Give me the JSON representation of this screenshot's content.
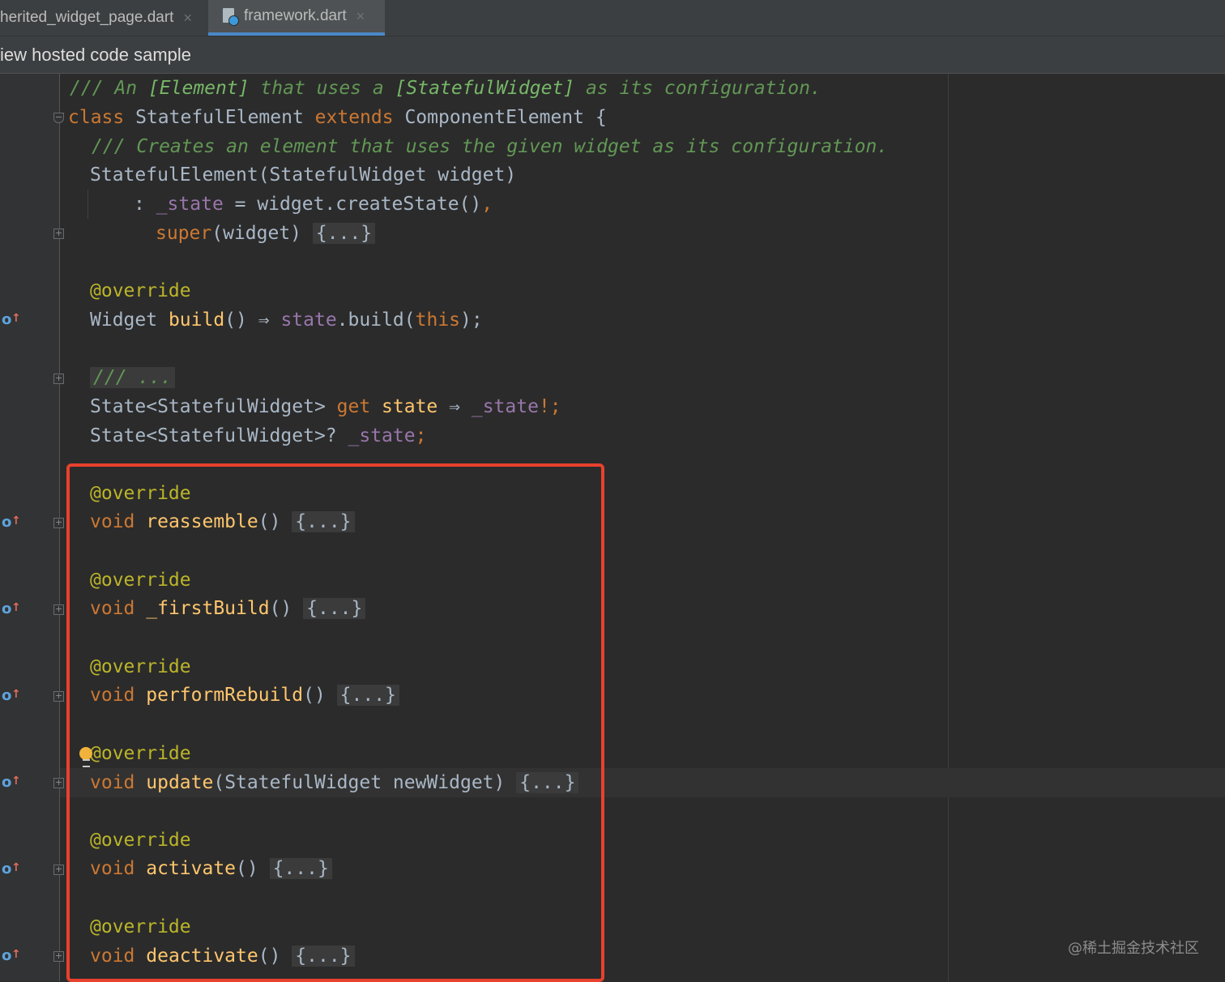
{
  "tabs": [
    {
      "label": "herited_widget_page.dart",
      "close": "×",
      "active": false
    },
    {
      "label": "framework.dart",
      "close": "×",
      "active": true
    }
  ],
  "hosted_banner": "iew hosted code sample",
  "code": {
    "l1": {
      "p1": "/// An ",
      "p2": "[Element]",
      "p3": " that uses a ",
      "p4": "[StatefulWidget]",
      "p5": " as its configuration."
    },
    "l2": {
      "kw1": "class",
      "p1": " StatefulElement ",
      "kw2": "extends",
      "p2": " ComponentElement {"
    },
    "l3": "/// Creates an element that uses the given widget as its configuration.",
    "l4": "StatefulElement(StatefulWidget widget)",
    "l5": {
      "p1": ": ",
      "fld": "_state",
      "p2": " = widget.createState()",
      "p3": ","
    },
    "l6": {
      "kw": "super",
      "p1": "(widget) ",
      "fold": "{...}"
    },
    "l7": "@override",
    "l8": {
      "p1": "Widget ",
      "fn": "build",
      "p2": "() ⇒ ",
      "fld": "state",
      "p3": ".build(",
      "kw": "this",
      "p4": ");"
    },
    "l9": "/// ...",
    "l10": {
      "p1": "State<StatefulWidget> ",
      "kw": "get",
      "p2": " ",
      "fn": "state",
      "p3": " ⇒ ",
      "fld": "_state",
      "p4": "!;"
    },
    "l11": {
      "p1": "State<StatefulWidget>? ",
      "fld": "_state",
      "p2": ";"
    },
    "m1": {
      "ann": "@override",
      "kw": "void",
      "fn": "reassemble",
      "args": "() ",
      "fold": "{...}"
    },
    "m2": {
      "ann": "@override",
      "kw": "void",
      "fn": "_firstBuild",
      "args": "() ",
      "fold": "{...}"
    },
    "m3": {
      "ann": "@override",
      "kw": "void",
      "fn": "performRebuild",
      "args": "() ",
      "fold": "{...}"
    },
    "m4": {
      "ann": "@override",
      "kw": "void",
      "fn": "update",
      "args": "(StatefulWidget newWidget) ",
      "fold": "{...}"
    },
    "m5": {
      "ann": "@override",
      "kw": "void",
      "fn": "activate",
      "args": "() ",
      "fold": "{...}"
    },
    "m6": {
      "ann": "@override",
      "kw": "void",
      "fn": "deactivate",
      "args": "() ",
      "fold": "{...}"
    }
  },
  "watermark": "@稀土掘金技术社区",
  "colors": {
    "keyword": "#cc7832",
    "doc_comment": "#629755",
    "annotation": "#bbb529",
    "function": "#ffc66d",
    "field": "#9876aa",
    "highlight_box": "#e8412d"
  }
}
